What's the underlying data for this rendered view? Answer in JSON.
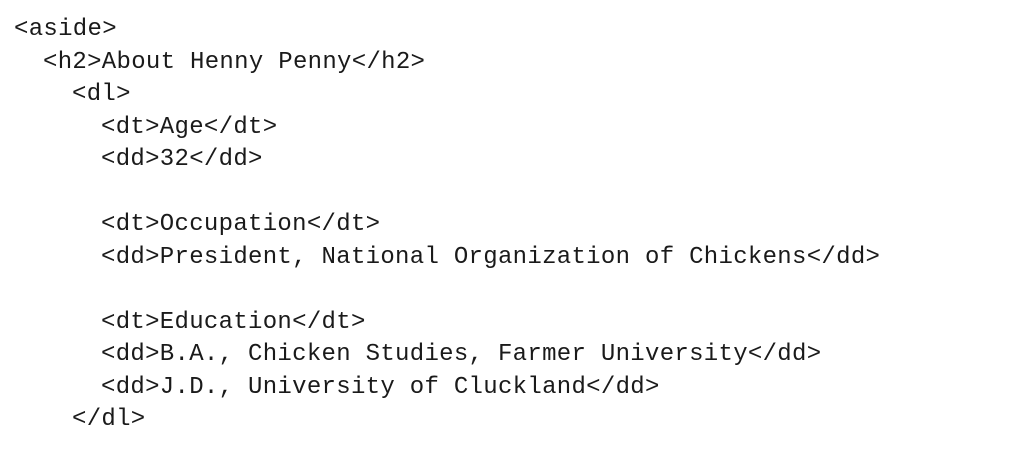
{
  "code": {
    "lines": [
      "<aside>",
      "<h2>About Henny Penny</h2>",
      "<dl>",
      "<dt>Age</dt>",
      "<dd>32</dd>",
      "",
      "<dt>Occupation</dt>",
      "<dd>President, National Organization of Chickens</dd>",
      "",
      "<dt>Education</dt>",
      "<dd>B.A., Chicken Studies, Farmer University</dd>",
      "<dd>J.D., University of Cluckland</dd>",
      "</dl>"
    ]
  }
}
